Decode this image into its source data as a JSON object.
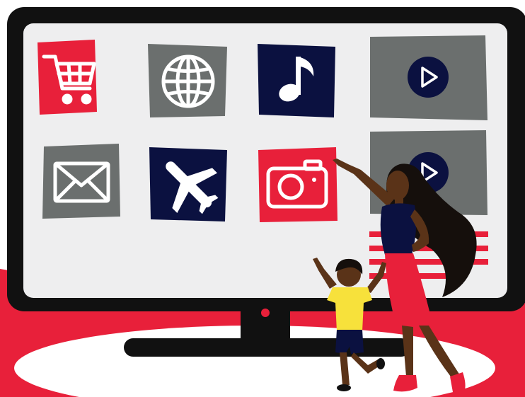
{
  "scene": {
    "description_icons": [
      "shopping-cart-icon",
      "globe-icon",
      "music-note-icon",
      "video-play-icon",
      "mail-icon",
      "airplane-icon",
      "camera-icon",
      "video-play-icon"
    ]
  },
  "colors": {
    "red": "#e8203a",
    "gray": "#6b6f6e",
    "navy": "#0b1140",
    "black": "#111111",
    "screen": "#eeeeef",
    "white": "#ffffff",
    "yellow": "#f7e13b",
    "skin": "#5a3318",
    "hair": "#150f0c"
  }
}
